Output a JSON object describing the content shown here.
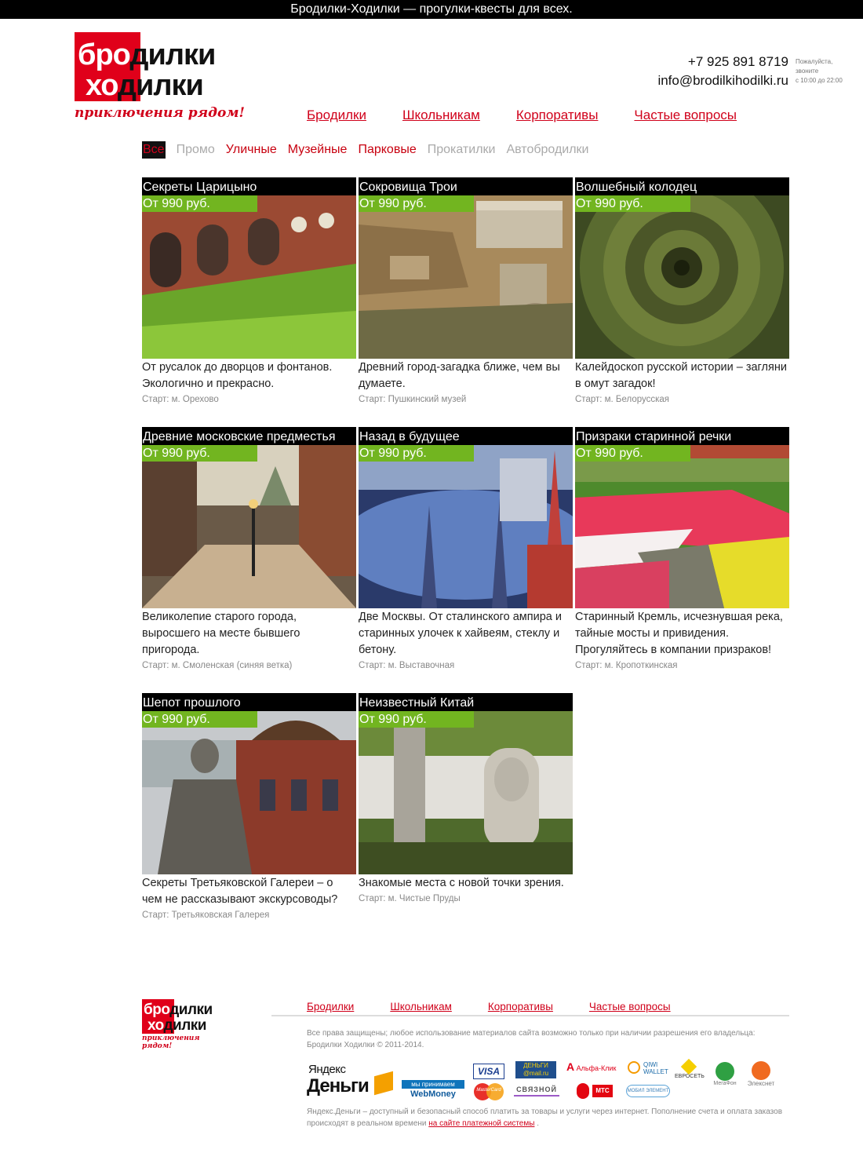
{
  "topbar": {
    "text": "Бродилки-Ходилки — прогулки-квесты для всех."
  },
  "logo": {
    "line1_a": "бро",
    "line1_b": "дилки",
    "line2_a": "хо",
    "line2_b": "дилки",
    "tagline": "приключения рядом!"
  },
  "contact": {
    "phone": "+7 925 891 8719",
    "email": "info@brodilkihodilki.ru",
    "note_1": "Пожалуйста,",
    "note_2": "звоните",
    "note_3": "с 10:00 до 22:00"
  },
  "nav": [
    "Бродилки",
    "Школьникам",
    "Корпоративы",
    "Частые вопросы"
  ],
  "filters": {
    "all": "Все",
    "promo": "Промо",
    "street": "Уличные",
    "museum": "Музейные",
    "park": "Парковые",
    "rides": "Прокатилки",
    "auto": "Автобродилки"
  },
  "cards": [
    {
      "title": "Секреты Царицыно",
      "price": "От 990 руб.",
      "desc": "От русалок до дворцов и фонтанов. Экологично и прекрасно.",
      "start": "Старт: м. Орехово"
    },
    {
      "title": "Сокровища Трои",
      "price": "От 990 руб.",
      "desc": "Древний город-загадка ближе, чем вы думаете.",
      "start": "Старт: Пушкинский музей"
    },
    {
      "title": "Волшебный колодец",
      "price": "От 990 руб.",
      "desc": "Калейдоскоп русской истории – загляни в омут загадок!",
      "start": "Старт: м. Белорусская"
    },
    {
      "title": "Древние московские предместья",
      "price": "От 990 руб.",
      "desc": "Великолепие старого города, выросшего на месте бывшего пригорода.",
      "start": "Старт: м. Смоленская (синяя ветка)"
    },
    {
      "title": "Назад в будущее",
      "price": "От 990 руб.",
      "desc": "Две Москвы. От сталинского ампира и старинных улочек к хайвеям, стеклу и бетону.",
      "start": "Старт: м. Выставочная"
    },
    {
      "title": "Призраки старинной речки",
      "price": "От 990 руб.",
      "desc": "Старинный Кремль, исчезнувшая река, тайные мосты и привидения. Прогуляйтесь в компании призраков!",
      "start": "Старт: м. Кропоткинская"
    },
    {
      "title": "Шепот прошлого",
      "price": "От 990 руб.",
      "desc": "Секреты Третьяковской Галереи – о чем не рассказывают экскурсоводы?",
      "start": "Старт: Третьяковская Галерея"
    },
    {
      "title": "Неизвестный Китай",
      "price": "От 990 руб.",
      "desc": "Знакомые места с новой точки зрения.",
      "start": "Старт: м. Чистые Пруды"
    }
  ],
  "footer": {
    "copyright": "Все права защищены; любое использование материалов сайта возможно только при наличии разрешения его владельца: Бродилки Ходилки © 2011-2014.",
    "pay_note": "Яндекс.Деньги – доступный и безопасный способ платить за товары и услуги через интернет. Пополнение счета и оплата заказов происходят в реальном времени",
    "pay_link": "на сайте платежной системы",
    "pay_tail": ".",
    "payments": {
      "yandex_1": "Яндекс",
      "yandex_2": "Деньги",
      "webmoney_top": "мы принимаем",
      "webmoney": "WebMoney",
      "visa": "VISA",
      "mastercard": "MasterCard",
      "dengi_mail": "ДЕНЬГИ @mail.ru",
      "svyaznoy": "СВЯЗНОЙ",
      "alfa": "Альфа-Клик",
      "mts": "МТС",
      "qiwi": "QIWI WALLET",
      "mobil": "МОБИЛ ЭЛЕМЕНТ",
      "evroset": "ЕВРОСЕТЬ",
      "megafon": "МегаФон",
      "elex": "Элекснет"
    }
  },
  "colors": {
    "brand_red": "#e0001a",
    "link_red": "#d0001a",
    "price_green": "#72b520"
  }
}
